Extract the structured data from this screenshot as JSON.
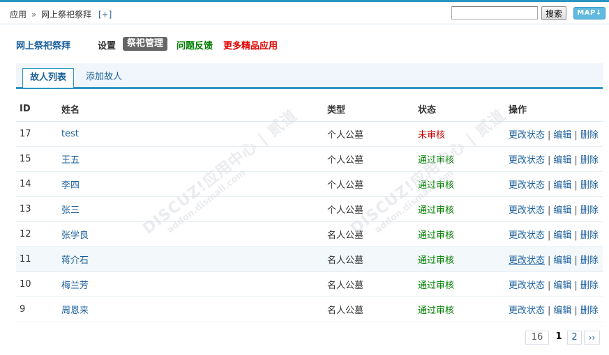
{
  "header": {
    "breadcrumb": {
      "root": "应用",
      "separator": "»",
      "current": "网上祭祀祭拜",
      "add": "[+]"
    },
    "search": {
      "value": "",
      "button_label": "搜索"
    },
    "map_button": "MAP"
  },
  "app_nav": {
    "title": "网上祭祀祭拜",
    "items": [
      "设置",
      "祭祀管理",
      "问题反馈",
      "更多精品应用"
    ],
    "active": "祭祀管理"
  },
  "tabs": [
    {
      "label": "故人列表",
      "active": true
    },
    {
      "label": "添加故人",
      "active": false
    }
  ],
  "table": {
    "headers": [
      "ID",
      "姓名",
      "类型",
      "状态",
      "操作"
    ],
    "rows": [
      {
        "id": "17",
        "name": "test",
        "type": "个人公墓",
        "status": "未审核",
        "status_kind": "pending"
      },
      {
        "id": "15",
        "name": "王五",
        "type": "个人公墓",
        "status": "通过审核",
        "status_kind": "ok"
      },
      {
        "id": "14",
        "name": "李四",
        "type": "个人公墓",
        "status": "通过审核",
        "status_kind": "ok"
      },
      {
        "id": "13",
        "name": "张三",
        "type": "个人公墓",
        "status": "通过审核",
        "status_kind": "ok"
      },
      {
        "id": "12",
        "name": "张学良",
        "type": "名人公墓",
        "status": "通过审核",
        "status_kind": "ok"
      },
      {
        "id": "11",
        "name": "蒋介石",
        "type": "名人公墓",
        "status": "通过审核",
        "status_kind": "ok"
      },
      {
        "id": "10",
        "name": "梅兰芳",
        "type": "名人公墓",
        "status": "通过审核",
        "status_kind": "ok"
      },
      {
        "id": "9",
        "name": "周恩来",
        "type": "名人公墓",
        "status": "通过审核",
        "status_kind": "ok"
      }
    ],
    "operations": [
      "更改状态",
      "编辑",
      "删除"
    ],
    "operation_separator": "|"
  },
  "pagination": {
    "total": "16",
    "current": "1",
    "next_page": "2",
    "next_label": "››"
  },
  "watermark": {
    "brand": "DISCUZ!应用中心 | 贰道",
    "url": "addon.dismall.com"
  },
  "colors": {
    "accent": "#2b95c2",
    "link": "#1a5f9c",
    "status_ok": "#008000",
    "status_pending": "#cc0000",
    "feedback": "#008000",
    "more_apps": "#e00000"
  }
}
